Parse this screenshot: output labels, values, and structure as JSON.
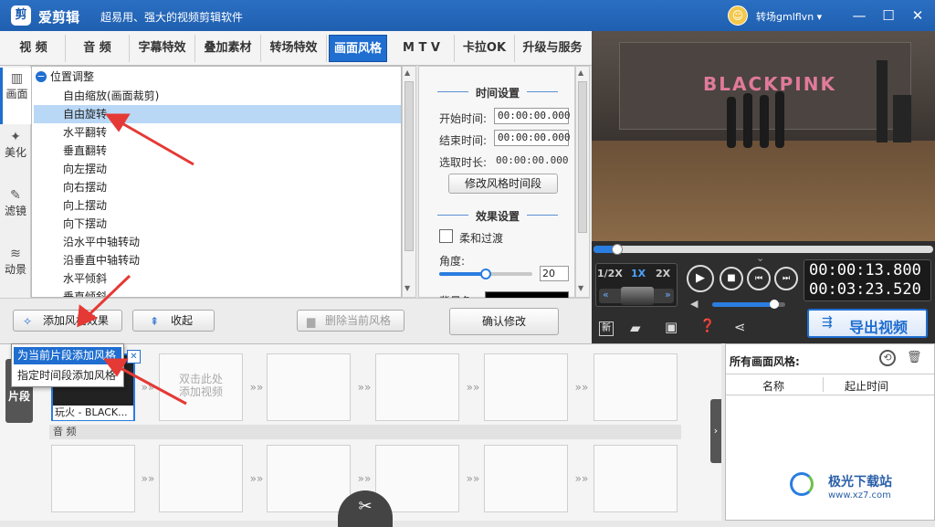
{
  "window": {
    "app_name": "爱剪辑",
    "slogan": "超易用、强大的视频剪辑软件",
    "username": "转场gmlflvn",
    "logo_glyph": "剪",
    "minimize": "—",
    "maximize": "☐",
    "close": "✕"
  },
  "tabs": [
    "视 频",
    "音 频",
    "字幕特效",
    "叠加素材",
    "转场特效",
    "画面风格",
    "M T V",
    "卡拉OK",
    "升级与服务"
  ],
  "active_tab_index": 5,
  "side_tabs": [
    {
      "label": "画面",
      "icon": "film-icon"
    },
    {
      "label": "美化",
      "icon": "sparkle-icon"
    },
    {
      "label": "滤镜",
      "icon": "wand-icon"
    },
    {
      "label": "动景",
      "icon": "wave-icon"
    }
  ],
  "style_list": {
    "group": "位置调整",
    "group_toggle": "−",
    "items": [
      "自由缩放(画面裁剪)",
      "自由旋转",
      "水平翻转",
      "垂直翻转",
      "向左摆动",
      "向右摆动",
      "向上摆动",
      "向下摆动",
      "沿水平中轴转动",
      "沿垂直中轴转动",
      "水平倾斜",
      "垂直倾斜"
    ],
    "selected_index": 1
  },
  "time_settings": {
    "title": "时间设置",
    "start_label": "开始时间:",
    "start_value": "00:00:00.000",
    "end_label": "结束时间:",
    "end_value": "00:00:00.000",
    "duration_label": "选取时长:",
    "duration_value": "00:00:00.000",
    "modify_button": "修改风格时间段"
  },
  "effect_settings": {
    "title": "效果设置",
    "smooth_label": "柔和过渡",
    "angle_label": "角度:",
    "angle_value": "20",
    "angle_fraction": 0.5,
    "bgcolor_label": "背景色:"
  },
  "actions": {
    "add_style": "添加风格效果",
    "collapse": "收起",
    "delete_style": "删除当前风格",
    "confirm": "确认修改"
  },
  "context_menu": {
    "item1": "为当前片段添加风格",
    "item2": "指定时间段添加风格",
    "close_glyph": "✕"
  },
  "player": {
    "scene_text": "BLACKPINK",
    "progress_fraction": 0.07,
    "speeds": [
      "1/2X",
      "1X",
      "2X"
    ],
    "active_speed": "1X",
    "current_time": "00:00:13.800",
    "total_time": "00:03:23.520",
    "volume_fraction": 0.85,
    "new_label": "新",
    "play_glyph": "▶",
    "stop_glyph": "■",
    "prev_glyph": "⏮",
    "next_glyph": "⏭",
    "rewind_glyph": "«",
    "forward_glyph": "»",
    "volume_glyph": "◀",
    "export_label": "导出视频",
    "tray_glyph": "⌄"
  },
  "timeline": {
    "side_label": "片段",
    "clip_name": "玩火 - BLACK...",
    "placeholder": "双击此处\n添加视频",
    "audio_label": "音 频",
    "arrow_glyph": "»»",
    "cut_glyph": "✂",
    "expand_glyph": "›"
  },
  "right_panel": {
    "title": "所有画面风格:",
    "col_name": "名称",
    "col_time": "起止时间",
    "back_glyph": "⟲",
    "trash_glyph": "🗑"
  },
  "watermark": {
    "name": "极光下载站",
    "url": "www.xz7.com"
  },
  "colors": {
    "title_bar": "#1f5fb0",
    "accent": "#1f6ed0",
    "selection": "#b9d8f6",
    "arrow": "#e53935"
  }
}
